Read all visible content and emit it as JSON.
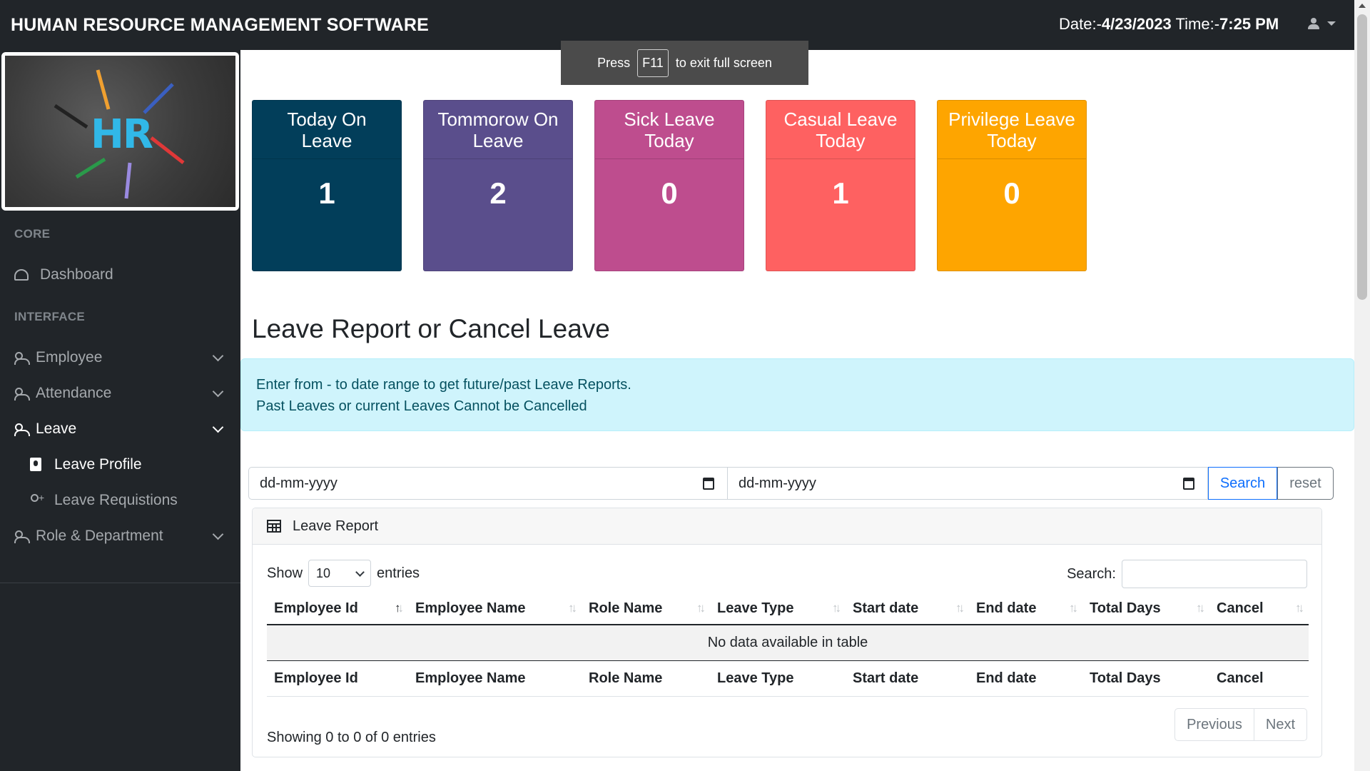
{
  "header": {
    "brand": "HUMAN RESOURCE MANAGEMENT SOFTWARE",
    "date_label": "Date:-",
    "date_value": "4/23/2023",
    "time_label": "Time:-",
    "time_value": "7:25 PM"
  },
  "toast": {
    "press": "Press",
    "key": "F11",
    "suffix": "to exit full screen"
  },
  "sidebar": {
    "logo_text": "HR",
    "core_heading": "CORE",
    "dashboard": "Dashboard",
    "interface_heading": "INTERFACE",
    "items": [
      {
        "label": "Employee"
      },
      {
        "label": "Attendance"
      },
      {
        "label": "Leave"
      },
      {
        "label": "Role & Department"
      }
    ],
    "leave_sub": [
      {
        "label": "Leave Profile"
      },
      {
        "label": "Leave Requistions"
      }
    ]
  },
  "cards": [
    {
      "title": "Today On Leave",
      "value": "1",
      "color": "#023e5a"
    },
    {
      "title": "Tommorow On Leave",
      "value": "2",
      "color": "#5a4e8c"
    },
    {
      "title": "Sick Leave Today",
      "value": "0",
      "color": "#be4d8e"
    },
    {
      "title": "Casual Leave Today",
      "value": "1",
      "color": "#fe6161"
    },
    {
      "title": "Privilege Leave Today",
      "value": "0",
      "color": "#fea500"
    }
  ],
  "main": {
    "title": "Leave Report or Cancel Leave",
    "alert_line1": "Enter from - to date range to get future/past Leave Reports.",
    "alert_line2": "Past Leaves or current Leaves Cannot be Cancelled",
    "from_placeholder": "dd-mm-yyyy",
    "to_placeholder": "dd-mm-yyyy",
    "search_button": "Search",
    "reset_button": "reset"
  },
  "report": {
    "header": "Leave Report",
    "show_label": "Show",
    "entries_value": "10",
    "entries_label": "entries",
    "search_label": "Search:",
    "columns": [
      "Employee Id",
      "Employee Name",
      "Role Name",
      "Leave Type",
      "Start date",
      "End date",
      "Total Days",
      "Cancel"
    ],
    "empty_text": "No data available in table",
    "info": "Showing 0 to 0 of 0 entries",
    "prev": "Previous",
    "next": "Next"
  }
}
